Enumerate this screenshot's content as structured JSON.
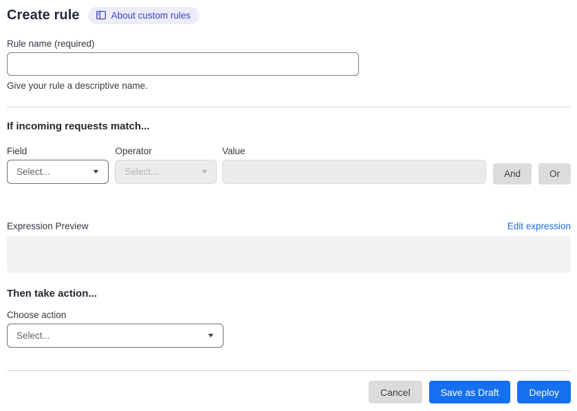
{
  "header": {
    "title": "Create rule",
    "about_badge_label": "About custom rules"
  },
  "colors": {
    "primary_blue": "#1570ef",
    "link_blue": "#1b6de0",
    "badge_bg": "#ededfa",
    "badge_text": "#3a41c6",
    "disabled_bg": "#ebebeb",
    "preview_bg": "#f2f2f2",
    "gray_button_bg": "#dcdcdc"
  },
  "rule_name": {
    "label": "Rule name (required)",
    "value": "",
    "placeholder": "",
    "help": "Give your rule a descriptive name."
  },
  "match": {
    "heading": "If incoming requests match...",
    "field": {
      "label": "Field",
      "selected": "Select..."
    },
    "operator": {
      "label": "Operator",
      "selected": "Select...",
      "disabled": true
    },
    "value": {
      "label": "Value",
      "value": "",
      "placeholder": "",
      "disabled": true
    },
    "and_button": "And",
    "or_button": "Or",
    "expression_preview_label": "Expression Preview",
    "edit_expression_link": "Edit expression",
    "expression_value": ""
  },
  "action": {
    "heading": "Then take action...",
    "choose_label": "Choose action",
    "selected": "Select..."
  },
  "footer": {
    "cancel": "Cancel",
    "save_draft": "Save as Draft",
    "deploy": "Deploy"
  }
}
